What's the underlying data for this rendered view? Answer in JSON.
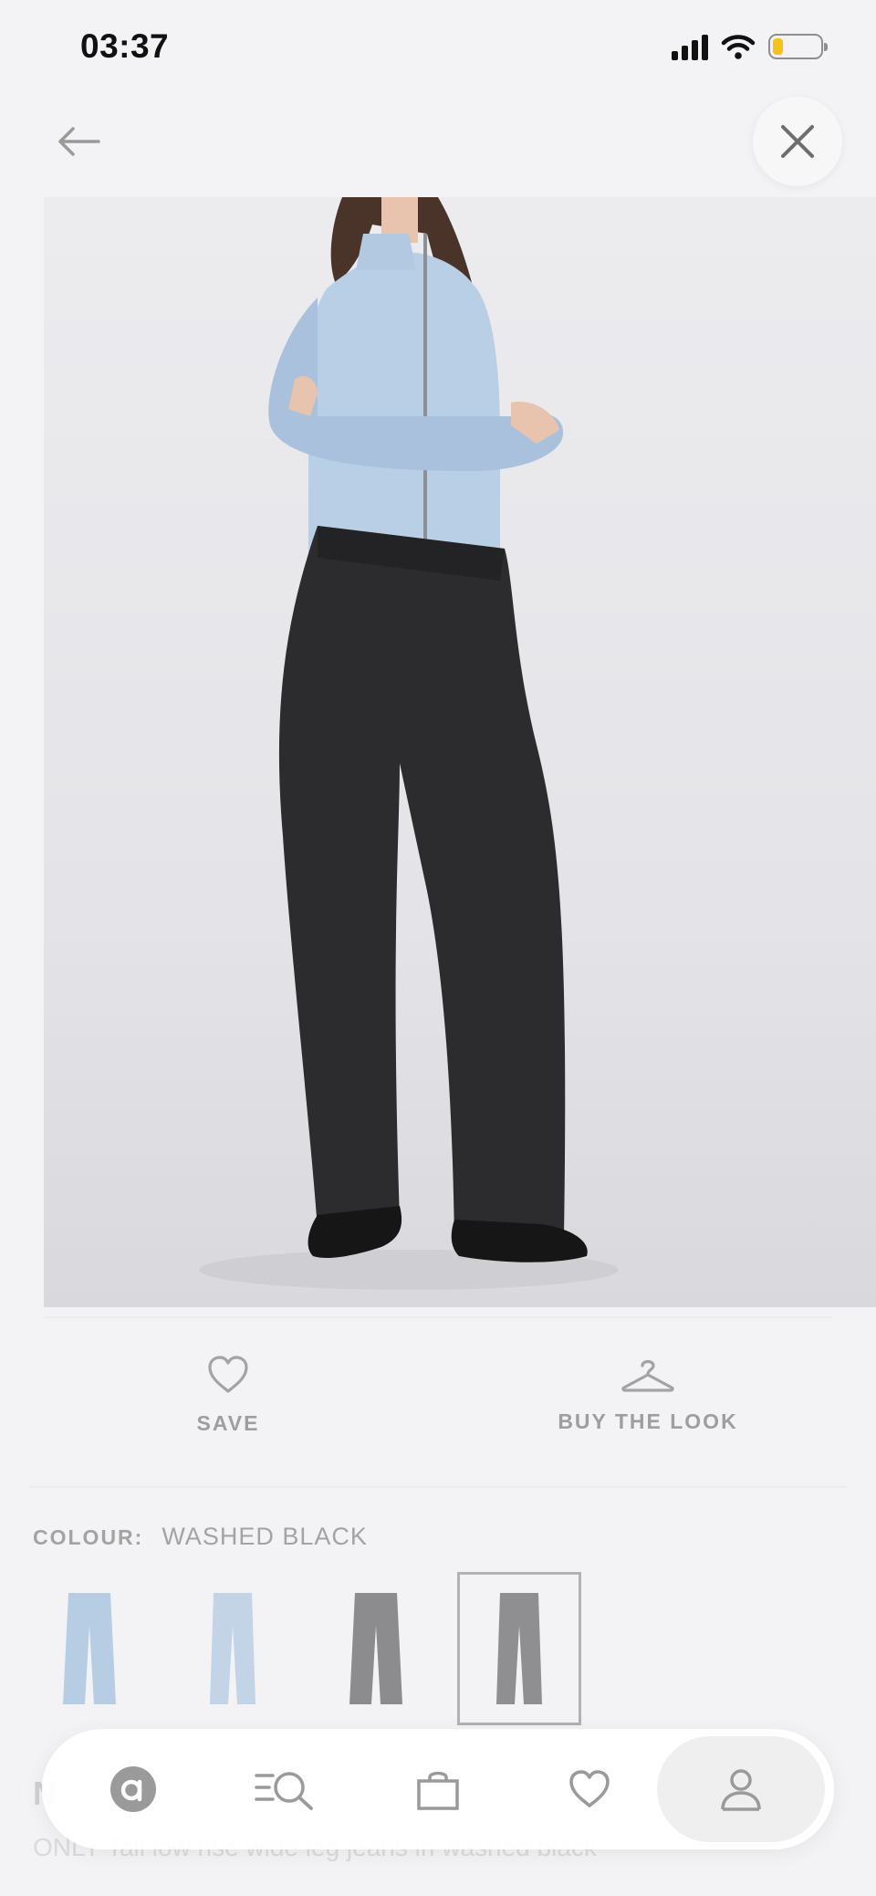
{
  "status_bar": {
    "time": "03:37",
    "icons": [
      "signal-icon",
      "wifi-icon",
      "battery-icon"
    ],
    "battery_color": "#f4c21a"
  },
  "nav": {
    "back_icon": "arrow-left-icon",
    "close_icon": "close-icon"
  },
  "product_image": {
    "description_icon": "product-photo",
    "top_color": "#b9cfe6",
    "jeans_color": "#2c2b2d"
  },
  "actions": {
    "save_label": "SAVE",
    "save_icon": "heart-icon",
    "buy_look_label": "BUY THE LOOK",
    "buy_look_icon": "hanger-icon"
  },
  "colour": {
    "key": "COLOUR:",
    "value": "WASHED BLACK",
    "swatches": [
      {
        "color": "#b6cde4",
        "selected": false
      },
      {
        "color": "#c3d4e6",
        "selected": false
      },
      {
        "color": "#8c8c8e",
        "selected": false
      },
      {
        "color": "#8f8f91",
        "selected": true
      }
    ]
  },
  "below_fold": {
    "title_fragment": "N",
    "description": "ONLY Tall low rise wide leg jeans in washed black"
  },
  "tab_bar": {
    "items": [
      {
        "name": "home",
        "icon": "asos-logo-icon"
      },
      {
        "name": "search",
        "icon": "search-icon"
      },
      {
        "name": "bag",
        "icon": "bag-icon"
      },
      {
        "name": "saved",
        "icon": "heart-icon"
      },
      {
        "name": "account",
        "icon": "user-icon",
        "active": true
      }
    ]
  }
}
